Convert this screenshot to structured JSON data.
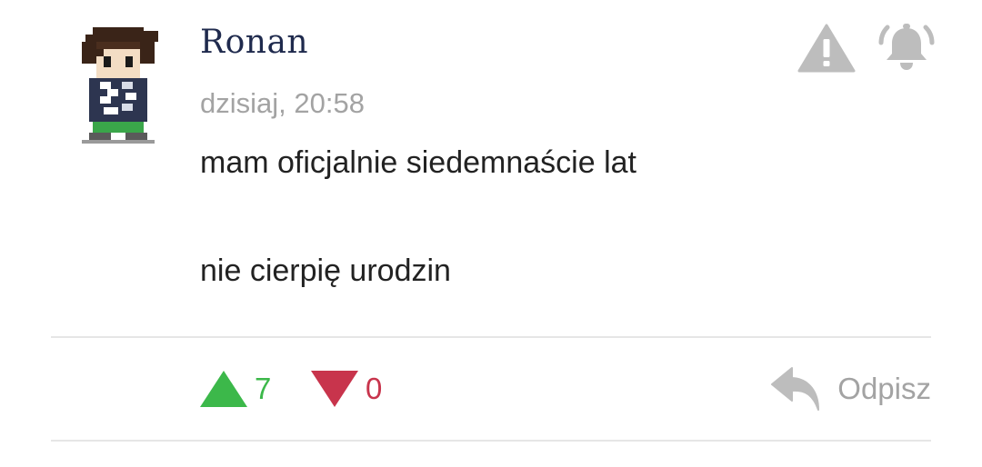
{
  "comment": {
    "author": "Ronan",
    "timestamp": "dzisiaj, 20:58",
    "body_lines": [
      "mam oficjalnie siedemnaście lat",
      "nie cierpię urodzin"
    ]
  },
  "actions": {
    "report_icon": "warning-triangle-icon",
    "subscribe_icon": "bell-icon",
    "reply_icon": "reply-arrow-icon",
    "reply_label": "Odpisz"
  },
  "votes": {
    "upvotes": "7",
    "downvotes": "0",
    "up_color": "#3cb84a",
    "down_color": "#c8344c"
  },
  "colors": {
    "author": "#1f2a4d",
    "muted": "#a3a3a3",
    "icon_gray": "#bdbdbd",
    "divider": "#e6e6e6"
  }
}
